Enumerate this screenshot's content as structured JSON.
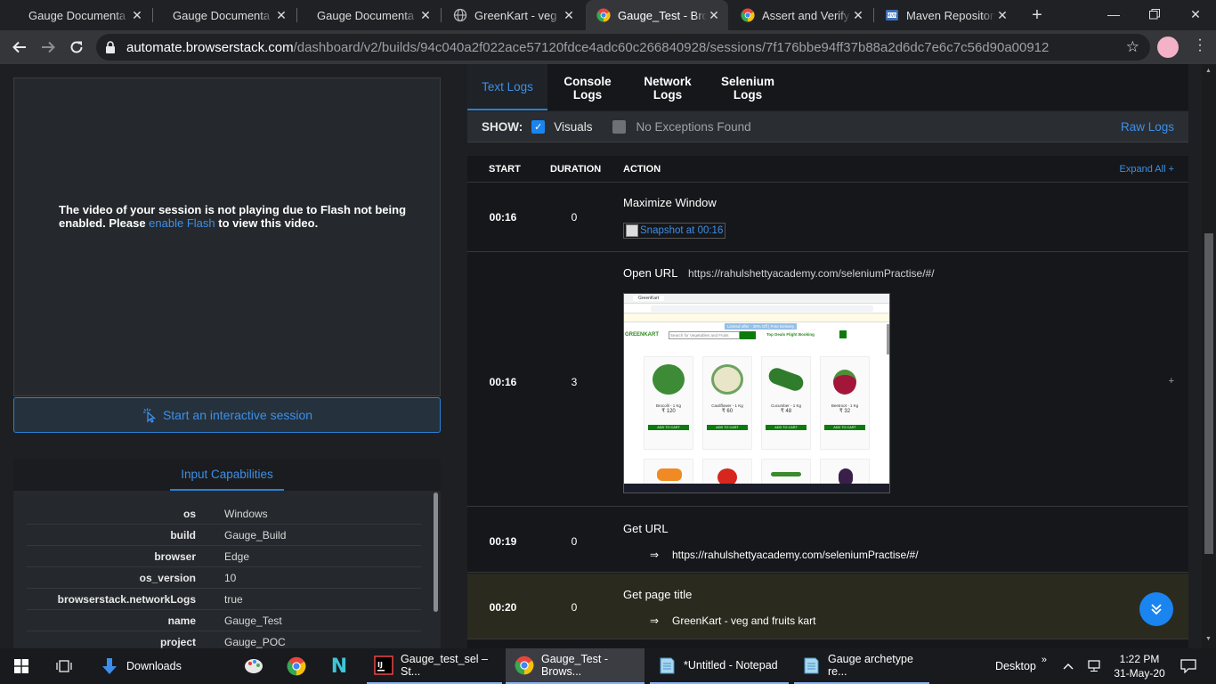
{
  "browser": {
    "tabs": [
      {
        "label": "Gauge Documenta",
        "favicon": "gauge-icon"
      },
      {
        "label": "Gauge Documenta",
        "favicon": "gauge-icon"
      },
      {
        "label": "Gauge Documenta",
        "favicon": "gauge-icon"
      },
      {
        "label": "GreenKart - veg ar",
        "favicon": "globe-icon"
      },
      {
        "label": "Gauge_Test - Brow",
        "favicon": "chrome-icon",
        "active": true
      },
      {
        "label": "Assert and Verify M",
        "favicon": "chrome-icon"
      },
      {
        "label": "Maven Repository:",
        "favicon": "maven-icon"
      }
    ],
    "new_tab": "+",
    "url_host": "automate.browserstack.com",
    "url_path": "/dashboard/v2/builds/94c040a2f022ace57120fdce4adc60c266840928/sessions/7f176bbe94ff37b88a2d6dc7e6c7c56d90a00912"
  },
  "video_panel": {
    "msg_before": "The video of your session is not playing due to Flash not being enabled. Please ",
    "msg_link": "enable Flash",
    "msg_after": " to view this video."
  },
  "interactive_button": "Start an interactive session",
  "capabilities": {
    "tab": "Input Capabilities",
    "rows": [
      {
        "key": "os",
        "value": "Windows"
      },
      {
        "key": "build",
        "value": "Gauge_Build"
      },
      {
        "key": "browser",
        "value": "Edge"
      },
      {
        "key": "os_version",
        "value": "10"
      },
      {
        "key": "browserstack.networkLogs",
        "value": "true"
      },
      {
        "key": "name",
        "value": "Gauge_Test"
      },
      {
        "key": "project",
        "value": "Gauge_POC"
      }
    ]
  },
  "log_tabs": {
    "text": "Text Logs",
    "console": "Console Logs",
    "network": "Network Logs",
    "selenium": "Selenium Logs"
  },
  "show_bar": {
    "label": "SHOW:",
    "visuals": "Visuals",
    "visuals_checked": true,
    "exceptions": "No Exceptions Found",
    "exceptions_checked": false,
    "raw_logs": "Raw Logs"
  },
  "log_table": {
    "headers": {
      "start": "START",
      "duration": "DURATION",
      "action": "ACTION",
      "expand": "Expand All +"
    },
    "rows": [
      {
        "start": "00:16",
        "duration": "0",
        "action": "Maximize Window",
        "detail": "Snapshot at 00:16"
      },
      {
        "start": "00:16",
        "duration": "3",
        "action": "Open URL",
        "detail": "https://rahulshettyacademy.com/seleniumPractise/#/",
        "expand": "+"
      },
      {
        "start": "00:19",
        "duration": "0",
        "action": "Get URL",
        "result_arrow": "⇒",
        "result": "https://rahulshettyacademy.com/seleniumPractise/#/"
      },
      {
        "start": "00:20",
        "duration": "0",
        "action": "Get page title",
        "result_arrow": "⇒",
        "result": "GreenKart - veg and fruits kart"
      }
    ]
  },
  "screenshot_page": {
    "brand": "GREENKART",
    "search_placeholder": "Search for Vegetables and Fruits",
    "promo": "Limited offer - 30% Off | Free Delivery",
    "links": "Top Deals  Flight Booking",
    "products": [
      {
        "name": "Brocolli - 1 Kg",
        "price": "₹ 120",
        "color": "#3d8b37"
      },
      {
        "name": "Cauliflower - 1 Kg",
        "price": "₹ 60",
        "color": "#e9e5c9"
      },
      {
        "name": "Cucumber - 1 Kg",
        "price": "₹ 48",
        "color": "#2f7d2c"
      },
      {
        "name": "Beetroot - 1 Kg",
        "price": "₹ 32",
        "color": "#a3163a"
      }
    ],
    "add_to_cart": "ADD TO CART"
  },
  "taskbar": {
    "downloads": "Downloads",
    "apps": [
      {
        "label": "Gauge_test_sel – St...",
        "icon": "intellij-icon"
      },
      {
        "label": "Gauge_Test - Brows...",
        "icon": "chrome-icon"
      },
      {
        "label": "*Untitled - Notepad",
        "icon": "notepad-icon"
      },
      {
        "label": "Gauge archetype re...",
        "icon": "notepad-icon"
      }
    ],
    "desktop": "Desktop",
    "time": "1:22 PM",
    "date": "31-May-20"
  },
  "colors": {
    "accent": "#3d8fe8",
    "highlight_row": "#2b2a1f",
    "fab": "#1a84f0"
  }
}
